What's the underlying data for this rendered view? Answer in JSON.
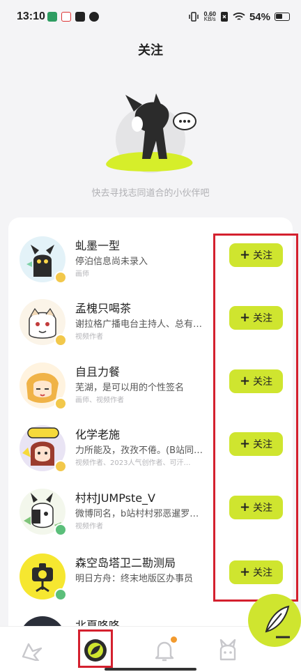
{
  "status_bar": {
    "time": "13:10",
    "net_speed_value": "0.60",
    "net_speed_unit": "KB/s",
    "battery": "54%"
  },
  "header": {
    "title": "关注"
  },
  "empty_state": {
    "hint": "快去寻找志同道合的小伙伴吧"
  },
  "follow_label": "关注",
  "users": [
    {
      "name": "虬墨一型",
      "bio": "停泊信息尚未录入",
      "tags": "画师"
    },
    {
      "name": "孟槐只喝茶",
      "bio": "谢拉格广播电台主持人、总有…",
      "tags": "视频作者"
    },
    {
      "name": "自且力餐",
      "bio": "芜湖，是可以用的个性签名",
      "tags": "画师、视频作者"
    },
    {
      "name": "化学老施",
      "bio": "力所能及，孜孜不倦。(B站同…",
      "tags": "视频作者、2023人气创作者、可汗…"
    },
    {
      "name": "村村JUMPste_V",
      "bio": "微博同名，b站村村邪恶暹罗…",
      "tags": "视频作者"
    },
    {
      "name": "森空岛塔卫二勘测局",
      "bio": "明日方舟：终末地版区办事员",
      "tags": ""
    },
    {
      "name": "北夏咚咚",
      "bio": "",
      "tags": ""
    }
  ],
  "nav": {
    "items": [
      "home-icon",
      "follow-icon",
      "notification-icon",
      "profile-icon"
    ],
    "active": "follow-icon",
    "accent": "#cfe52f",
    "highlight": "#d4202e"
  }
}
